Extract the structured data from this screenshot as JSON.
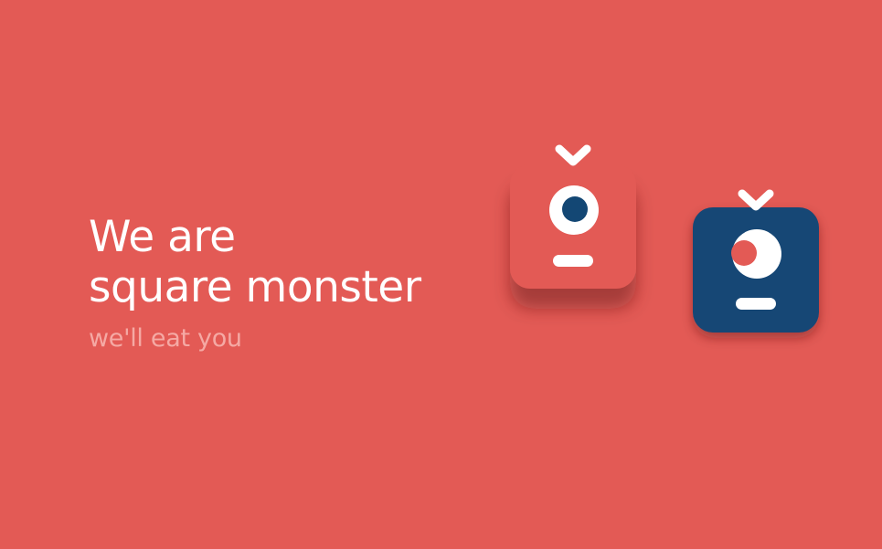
{
  "hero": {
    "title_line1": "We are",
    "title_line2": "square monster",
    "tagline": "we'll eat you"
  },
  "colors": {
    "background": "#e35a55",
    "monster_red": "#e35a55",
    "monster_blue": "#134774",
    "text_primary": "#ffffff",
    "text_secondary": "#f5a9a4"
  },
  "monsters": [
    {
      "name": "red-square-monster",
      "icon": "monster-icon",
      "body_color": "#e35a55",
      "pupil_color": "#134774"
    },
    {
      "name": "blue-square-monster",
      "icon": "monster-icon",
      "body_color": "#134774",
      "pupil_color": "#e35a55"
    }
  ]
}
